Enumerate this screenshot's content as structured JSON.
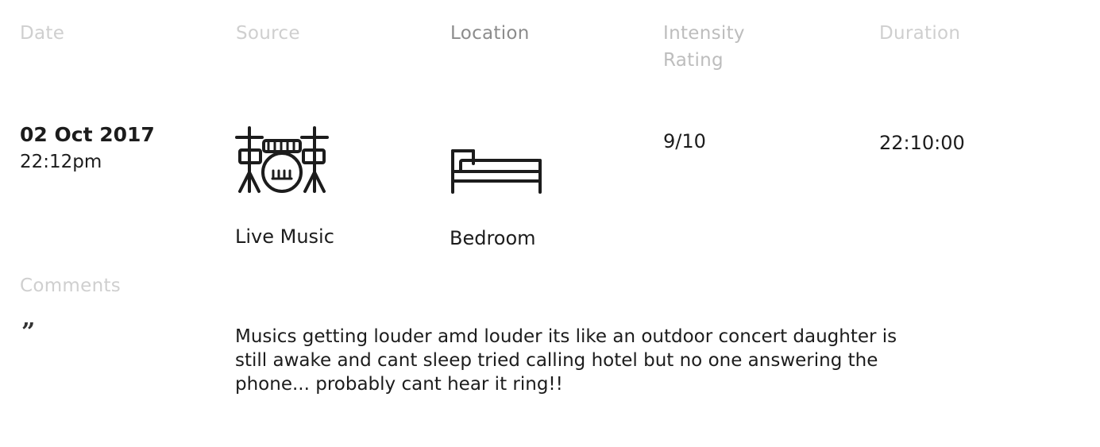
{
  "headers": {
    "date": "Date",
    "source": "Source",
    "location": "Location",
    "intensity_line1": "Intensity",
    "intensity_line2": "Rating",
    "duration": "Duration",
    "comments": "Comments"
  },
  "entry": {
    "date": "02 Oct 2017",
    "time": "22:12pm",
    "source": {
      "label": "Live Music",
      "icon": "drum-kit-icon"
    },
    "location": {
      "label": "Bedroom",
      "icon": "bed-icon"
    },
    "intensity": "9/10",
    "duration": "22:10:00",
    "comment": {
      "quote_icon": "quote-icon",
      "quote_glyph": "”",
      "text": "Musics getting louder amd louder its like an outdoor concert daughter is still awake and cant sleep tried calling hotel but no one answering the phone... probably cant hear it ring!!"
    }
  }
}
